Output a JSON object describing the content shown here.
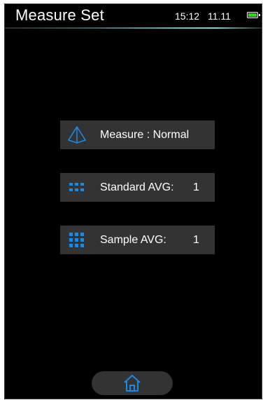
{
  "header": {
    "title": "Measure Set",
    "time": "15:12",
    "date": "11.11",
    "battery_icon": "battery-icon",
    "battery_color": "#19e219"
  },
  "menu": {
    "measure": {
      "icon": "pyramid-icon",
      "label": "Measure : Normal"
    },
    "standard_avg": {
      "icon": "grid-icon",
      "label": "Standard AVG:",
      "value": "1"
    },
    "sample_avg": {
      "icon": "grid-icon",
      "label": "Sample AVG:",
      "value": "1"
    }
  },
  "footer": {
    "home_icon": "home-icon"
  },
  "colors": {
    "accent": "#1e88e5",
    "button_bg": "#333333",
    "screen_bg": "#000000"
  }
}
